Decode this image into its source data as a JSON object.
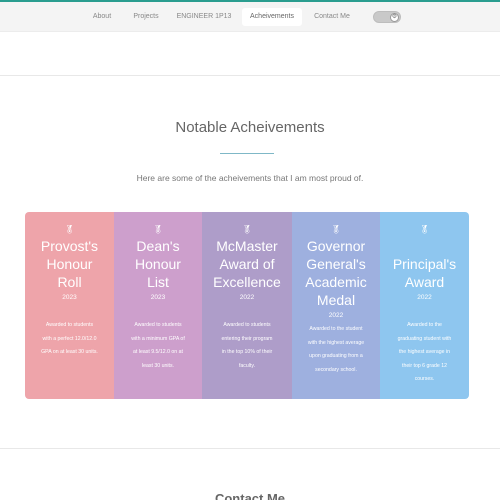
{
  "nav": {
    "items": [
      {
        "label": "About",
        "active": false
      },
      {
        "label": "Projects",
        "active": false
      },
      {
        "label": "ENGINEER 1P13",
        "active": false
      },
      {
        "label": "Acheivements",
        "active": true
      },
      {
        "label": "Contact Me",
        "active": false
      }
    ],
    "theme_toggle_icon": "gear-icon"
  },
  "achievements": {
    "title": "Notable Acheivements",
    "subtitle": "Here are some of the acheivements that I am most proud of.",
    "cards": [
      {
        "icon": "award-icon",
        "color": "#eea4aa",
        "title": "Provost's\nHonour\nRoll",
        "year": "2023",
        "description": "Awarded to students\nwith a perfect 12.0/12.0\nGPA on at least 30 units."
      },
      {
        "icon": "award-icon",
        "color": "#cd9fcc",
        "title": "Dean's\nHonour\nList",
        "year": "2023",
        "description": "Awarded to students\nwith a minimum GPA of\nat least 9.5/12.0 on at\nleast 30 units."
      },
      {
        "icon": "award-icon",
        "color": "#ae9dc9",
        "title": "McMaster\nAward of\nExcellence",
        "year": "2022",
        "description": "Awarded to students\nentering their program\nin the top 10% of their\nfaculty."
      },
      {
        "icon": "award-icon",
        "color": "#9eb0df",
        "title": "Governor\nGeneral's\nAcademic\nMedal",
        "year": "2022",
        "description": "Awarded to the student\nwith the highest average\nupon graduating from a\nsecondary school."
      },
      {
        "icon": "award-icon",
        "color": "#8ec6ef",
        "title": "Principal's\nAward",
        "year": "2022",
        "description": "Awarded to the\ngraduating student with\nthe highest average in\ntheir top 6 grade 12\ncourses."
      }
    ]
  },
  "contact": {
    "heading": "Contact Me"
  }
}
